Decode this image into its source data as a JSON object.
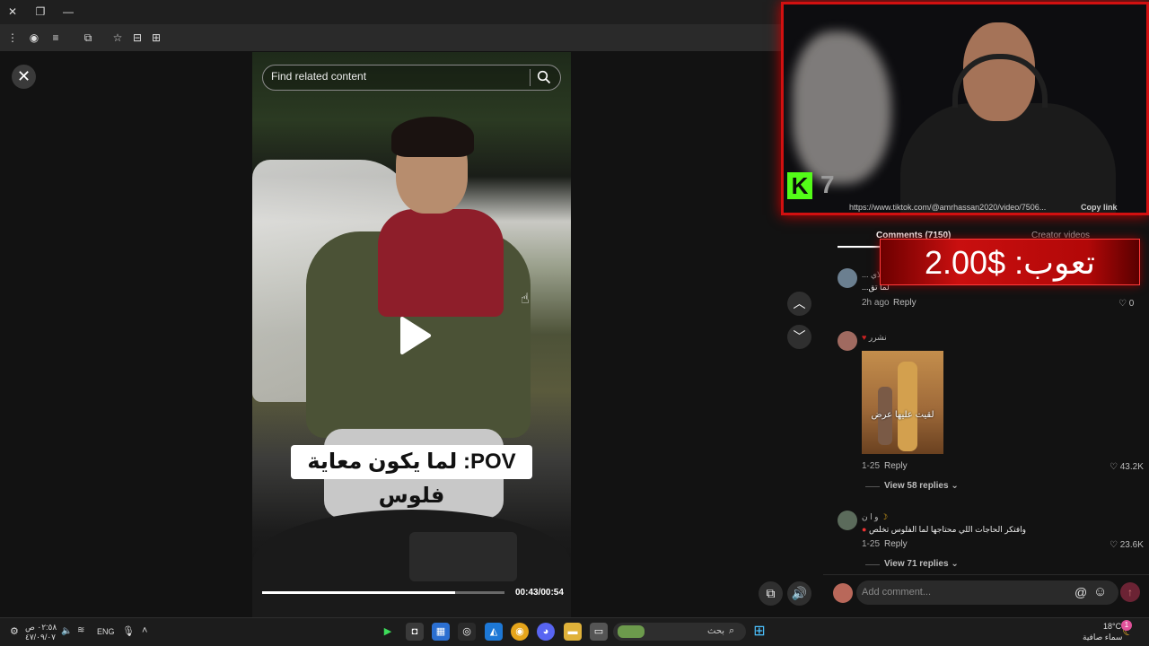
{
  "search": {
    "placeholder": "Find related content"
  },
  "video": {
    "caption": "POV: لما يكون معاية فلوس",
    "time": "00:43/00:54",
    "progress": 0.796
  },
  "overlay": {
    "viewer_count": "7",
    "kick_letter": "K",
    "url_text": "https://www.tiktok.com/@amrhassan2020/video/7506...",
    "copy_link": "Copy link",
    "donation": "تعوب: $2.00"
  },
  "comments": {
    "tab_comments": "Comments (7150)",
    "tab_creator": "Creator videos",
    "items": [
      {
        "user": "علاي ...",
        "text": "لما تق...",
        "time": "2h ago",
        "reply": "Reply",
        "likes": "0"
      },
      {
        "user": "نشرر",
        "image_text": "لقيت عليها عرض",
        "time": "1-25",
        "reply": "Reply",
        "likes": "43.2K",
        "view_replies": "View 58 replies"
      },
      {
        "user": "و ا ن",
        "text": "وافتكر الحاجات اللي محتاجها لما الفلوس تخلص",
        "time": "1-25",
        "reply": "Reply",
        "likes": "23.6K",
        "view_replies": "View 71 replies"
      }
    ],
    "add_placeholder": "Add comment..."
  },
  "taskbar": {
    "clock_time": "٠٢:٥٨ ص",
    "clock_date": "٤٧/٠٩/٠٧",
    "lang": "ENG",
    "search_text": "بحث",
    "weather_temp": "18°C",
    "weather_desc": "سماء صافية",
    "notif_count": "1"
  }
}
